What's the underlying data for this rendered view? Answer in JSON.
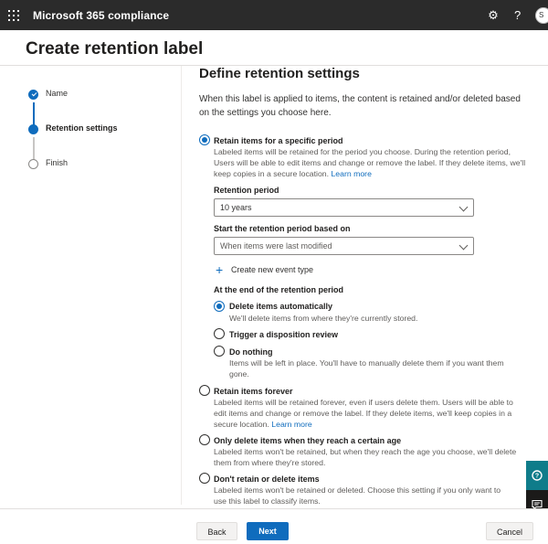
{
  "app": {
    "title": "Microsoft 365 compliance",
    "avatar_initials": "S"
  },
  "page": {
    "title": "Create retention label"
  },
  "steps": [
    {
      "label": "Name",
      "state": "done"
    },
    {
      "label": "Retention settings",
      "state": "current"
    },
    {
      "label": "Finish",
      "state": "todo"
    }
  ],
  "section": {
    "title": "Define retention settings",
    "intro": "When this label is applied to items, the content is retained and/or deleted based on the settings you choose here."
  },
  "options": {
    "retain_period": {
      "title": "Retain items for a specific period",
      "desc": "Labeled items will be retained for the period you choose. During the retention period, Users will be able to edit items and change or remove the label. If they delete items, we'll keep copies in a secure location.",
      "link": "Learn more",
      "selected": true
    },
    "retain_forever": {
      "title": "Retain items forever",
      "desc": "Labeled items will be retained forever, even if users delete them. Users will be able to edit items and change or remove the label. If they delete items, we'll keep copies in a secure location.",
      "link": "Learn more",
      "selected": false
    },
    "delete_at_age": {
      "title": "Only delete items when they reach a certain age",
      "desc": "Labeled items won't be retained, but when they reach the age you choose, we'll delete them from where they're stored.",
      "selected": false
    },
    "dont_retain": {
      "title": "Don't retain or delete items",
      "desc": "Labeled items won't be retained or deleted. Choose this setting if you only want to use this label to classify items.",
      "selected": false
    }
  },
  "retention_period": {
    "label": "Retention period",
    "value": "10 years"
  },
  "start_based_on": {
    "label": "Start the retention period based on",
    "placeholder": "When items were last modified"
  },
  "create_event_type": {
    "label": "Create new event type"
  },
  "end_of_period": {
    "heading": "At the end of the retention period",
    "delete_automatically": {
      "title": "Delete items automatically",
      "desc": "We'll delete items from where they're currently stored.",
      "selected": true
    },
    "disposition_review": {
      "title": "Trigger a disposition review",
      "selected": false
    },
    "do_nothing": {
      "title": "Do nothing",
      "desc": "Items will be left in place. You'll have to manually delete them if you want them gone.",
      "selected": false
    }
  },
  "footer": {
    "back": "Back",
    "next": "Next",
    "cancel": "Cancel"
  },
  "colors": {
    "accent": "#0f6cbd",
    "topbar": "#2b2b2b",
    "help_fab": "#0f7c8a"
  },
  "icons": {
    "waffle": "waffle-icon",
    "settings": "gear-icon",
    "help": "help-icon",
    "add": "plus-icon",
    "fab_help": "help-icon",
    "fab_feedback": "feedback-icon"
  }
}
